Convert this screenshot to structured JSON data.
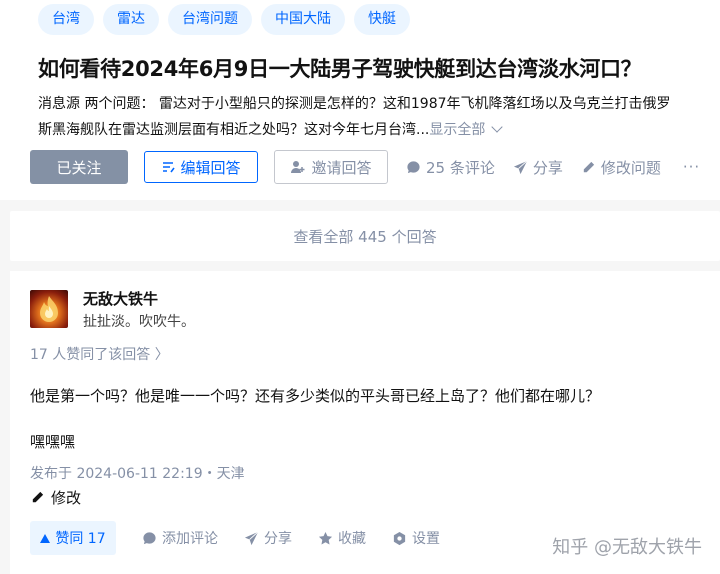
{
  "question": {
    "tags": [
      "台湾",
      "雷达",
      "台湾问题",
      "中国大陆",
      "快艇"
    ],
    "title": "如何看待2024年6月9日一大陆男子驾驶快艇到达台湾淡水河口？",
    "detail_line1": "消息源 两个问题： 雷达对于小型船只的探测是怎样的？这和1987年飞机降落红场以及乌克兰打击俄罗",
    "detail_line2": "斯黑海舰队在雷达监测层面有相近之处吗？这对今年七月台湾...",
    "show_all": "显示全部",
    "actions": {
      "followed": "已关注",
      "edit_answer": "编辑回答",
      "invite": "邀请回答",
      "comments": "25 条评论",
      "share": "分享",
      "modify": "修改问题",
      "more": "···"
    }
  },
  "view_all": "查看全部 445 个回答",
  "answer": {
    "author": "无敌大铁牛",
    "bio": "扯扯淡。吹吹牛。",
    "voters": "17 人赞同了该回答 〉",
    "paragraphs": [
      "他是第一个吗？他是唯一一个吗？还有多少类似的平头哥已经上岛了？他们都在哪儿？",
      "嘿嘿嘿"
    ],
    "published": "发布于 2024-06-11 22:19・天津",
    "edit": "修改",
    "bar": {
      "vote": "赞同 17",
      "comment": "添加评论",
      "share": "分享",
      "collect": "收藏",
      "settings": "设置"
    }
  },
  "watermark": "知乎 @无敌大铁牛",
  "colors": {
    "brand": "#0066ff",
    "muted": "#8590a6",
    "followed_bg": "#8491a5",
    "tag_bg": "#ebf5ff"
  }
}
